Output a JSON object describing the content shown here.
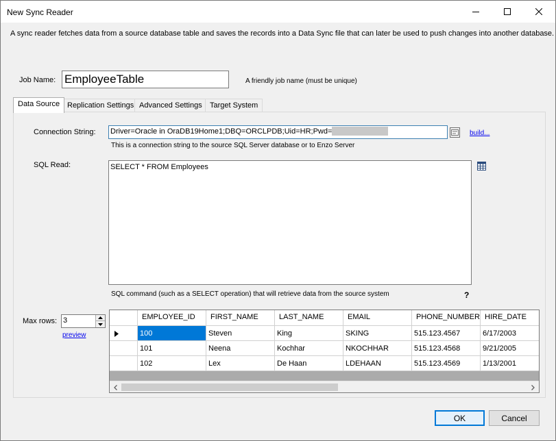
{
  "window": {
    "title": "New Sync Reader",
    "description": "A sync reader fetches data from a source database table and saves the records into a Data Sync file that can later be used to push changes into another database."
  },
  "job": {
    "label": "Job Name:",
    "value": "EmployeeTable",
    "hint": "A friendly job name (must be unique)"
  },
  "tabs": [
    "Data Source",
    "Replication Settings",
    "Advanced Settings",
    "Target System"
  ],
  "connection": {
    "label": "Connection String:",
    "value": "Driver=Oracle in OraDB19Home1;DBQ=ORCLPDB;Uid=HR;Pwd=",
    "hint": "This is a connection string to the source SQL Server database or to Enzo Server",
    "build_link": "build..."
  },
  "sql": {
    "label": "SQL Read:",
    "value": "SELECT * FROM Employees",
    "hint": "SQL command (such as a SELECT operation) that will retrieve data from the source system",
    "help": "?"
  },
  "maxrows": {
    "label": "Max rows:",
    "value": "3",
    "preview_link": "preview"
  },
  "grid": {
    "columns": [
      "EMPLOYEE_ID",
      "FIRST_NAME",
      "LAST_NAME",
      "EMAIL",
      "PHONE_NUMBER",
      "HIRE_DATE"
    ],
    "rows": [
      [
        "100",
        "Steven",
        "King",
        "SKING",
        "515.123.4567",
        "6/17/2003"
      ],
      [
        "101",
        "Neena",
        "Kochhar",
        "NKOCHHAR",
        "515.123.4568",
        "9/21/2005"
      ],
      [
        "102",
        "Lex",
        "De Haan",
        "LDEHAAN",
        "515.123.4569",
        "1/13/2001"
      ]
    ]
  },
  "buttons": {
    "ok": "OK",
    "cancel": "Cancel"
  },
  "colors": {
    "accent": "#0078d7",
    "link": "#0000ee"
  }
}
